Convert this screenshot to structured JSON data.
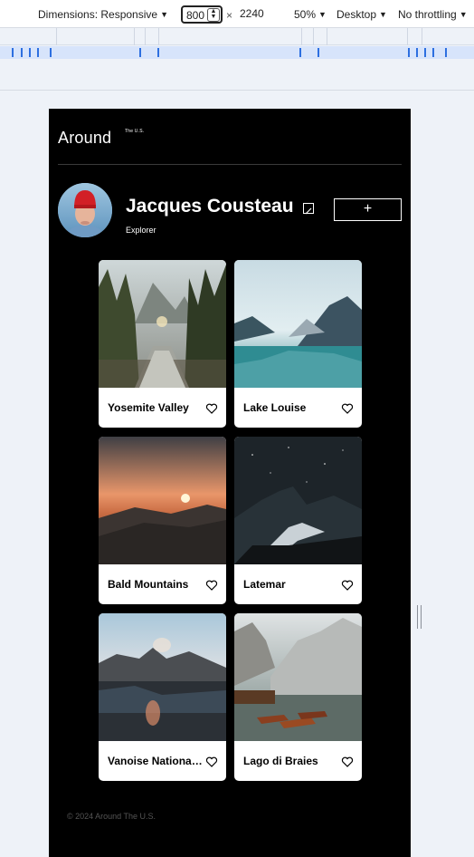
{
  "devtools": {
    "dimensions_label": "Dimensions: Responsive",
    "width_value": "800",
    "times_sign": "×",
    "height_value": "2240",
    "zoom_label": "50%",
    "device_mode_label": "Desktop",
    "throttling_label": "No throttling"
  },
  "page": {
    "logo_text": "Around",
    "logo_sup": "The U.S.",
    "profile": {
      "name": "Jacques Cousteau",
      "job": "Explorer",
      "add_label": "+"
    },
    "cards": [
      {
        "title": "Yosemite Valley"
      },
      {
        "title": "Lake Louise"
      },
      {
        "title": "Bald Mountains"
      },
      {
        "title": "Latemar"
      },
      {
        "title": "Vanoise National Park"
      },
      {
        "title": "Lago di Braies"
      }
    ],
    "footer": "© 2024 Around The U.S."
  },
  "colors": {
    "page_background": "#000000",
    "devtools_background": "#eef2f8",
    "ruler_accent": "#2d6fe0"
  },
  "icons": {
    "edit": "pencil-square-icon",
    "like": "heart-outline-icon",
    "dropdown": "caret-down-icon"
  }
}
